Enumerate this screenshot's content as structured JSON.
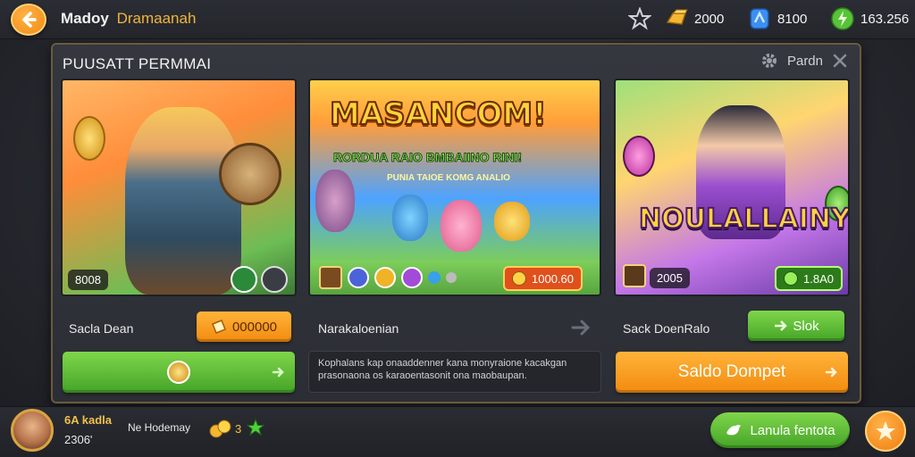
{
  "header": {
    "title_primary": "Madoy",
    "title_secondary": "Dramaanah",
    "resources": [
      {
        "icon": "gold-bar-icon",
        "value": "2000"
      },
      {
        "icon": "blue-gem-icon",
        "value": "8100"
      },
      {
        "icon": "green-energy-icon",
        "value": "163.256"
      }
    ]
  },
  "panel": {
    "title": "PUUSATT PERMMAI",
    "filter_label": "Pardn"
  },
  "cards": [
    {
      "badge": "8008",
      "label": "Sacla Dean",
      "orange_button": "000000",
      "wide_button": ""
    },
    {
      "logo_title": "MASANCOM!",
      "logo_sub": "RORDUA RAIO BMBAIINO RINI!",
      "logo_sub2": "PUNIA TAIOE KOMG ANALIO",
      "price_badge": "1000.60",
      "label": "Narakaloenian",
      "description": "Kophalans kap onaaddenner kana monyraione kacakgan prasonaona os karaoentasonit ona maobaupan."
    },
    {
      "logo_title": "NOULALLAINY",
      "badge": "2005",
      "green_badge": "1.8A0",
      "label": "Sack DoenRalo",
      "green_button": "Slok",
      "wide_button": "Saldo Dompet"
    }
  ],
  "footer": {
    "player_name": "6A kadla",
    "player_score": "2306'",
    "nickname": "Ne Hodemay",
    "stars": "3",
    "pill_button": "Lanula fentota"
  },
  "colors": {
    "accent_orange": "#f28b0f",
    "accent_green": "#45a428",
    "panel_border": "#6b5a3c"
  }
}
